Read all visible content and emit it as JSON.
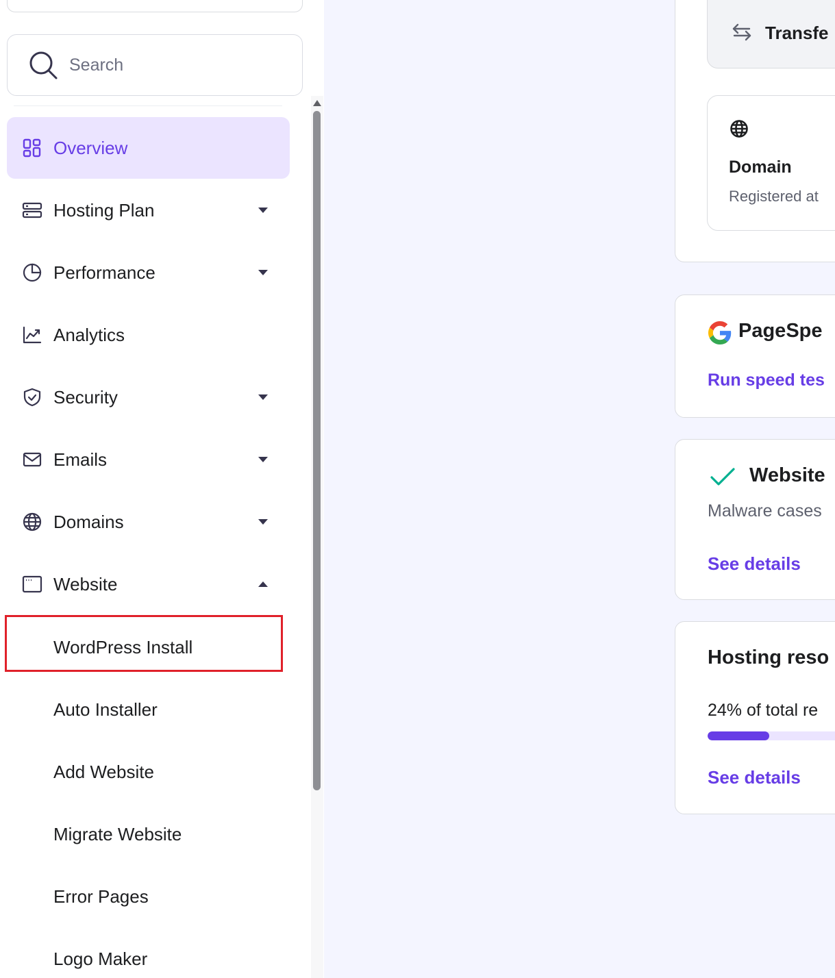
{
  "search": {
    "placeholder": "Search"
  },
  "sidebar": {
    "items": [
      {
        "label": "Overview",
        "icon": "grid-icon",
        "active": true
      },
      {
        "label": "Hosting Plan",
        "icon": "server-icon",
        "expanded": false
      },
      {
        "label": "Performance",
        "icon": "pie-chart-icon",
        "expanded": false
      },
      {
        "label": "Analytics",
        "icon": "line-chart-icon"
      },
      {
        "label": "Security",
        "icon": "shield-icon",
        "expanded": false
      },
      {
        "label": "Emails",
        "icon": "mail-icon",
        "expanded": false
      },
      {
        "label": "Domains",
        "icon": "globe-icon",
        "expanded": false
      },
      {
        "label": "Website",
        "icon": "browser-window-icon",
        "expanded": true
      }
    ],
    "website_subitems": [
      {
        "label": "WordPress Install",
        "highlighted": true
      },
      {
        "label": "Auto Installer"
      },
      {
        "label": "Add Website"
      },
      {
        "label": "Migrate Website"
      },
      {
        "label": "Error Pages"
      },
      {
        "label": "Logo Maker"
      }
    ]
  },
  "main": {
    "transfer": {
      "label": "Transfe",
      "icon": "transfer-arrows-icon"
    },
    "domain_card": {
      "title": "Domain",
      "subtitle": "Registered at",
      "icon": "globe-icon"
    },
    "pagespeed_card": {
      "title": "PageSpe",
      "link": "Run speed tes",
      "icon": "google-g-icon"
    },
    "security_card": {
      "title": "Website",
      "subtitle": "Malware cases",
      "link": "See details",
      "icon": "check-icon"
    },
    "resources_card": {
      "title": "Hosting reso",
      "usage_text": "24% of total re",
      "usage_percent": 24,
      "link": "See details"
    }
  },
  "colors": {
    "accent": "#673de6",
    "active_bg": "#ebe4ff",
    "highlight_border": "#e0212a",
    "main_bg": "#f4f5ff",
    "success": "#00b090"
  }
}
